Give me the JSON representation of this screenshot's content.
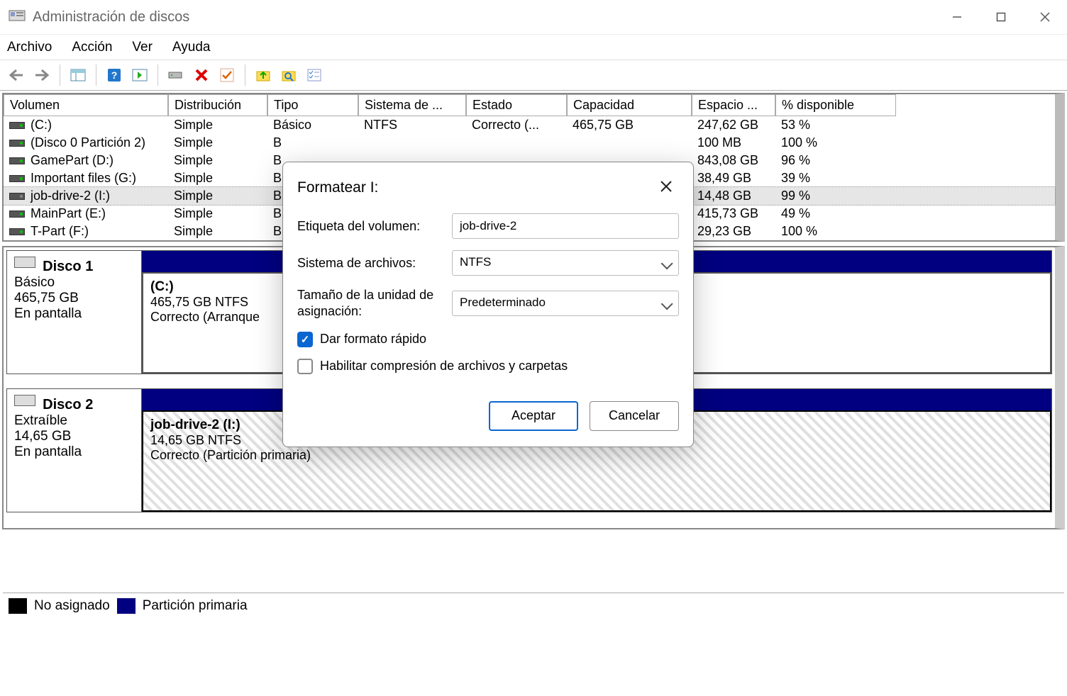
{
  "window": {
    "title": "Administración de discos"
  },
  "menu": {
    "file": "Archivo",
    "action": "Acción",
    "view": "Ver",
    "help": "Ayuda"
  },
  "columns": {
    "vol": "Volumen",
    "dist": "Distribución",
    "tipo": "Tipo",
    "fs": "Sistema de ...",
    "estado": "Estado",
    "cap": "Capacidad",
    "free": "Espacio ...",
    "pct": "% disponible"
  },
  "rows": [
    {
      "name": "(C:)",
      "dist": "Simple",
      "tipo": "Básico",
      "fs": "NTFS",
      "estado": "Correcto (...",
      "cap": "465,75 GB",
      "free": "247,62 GB",
      "pct": "53 %"
    },
    {
      "name": "(Disco 0 Partición 2)",
      "dist": "Simple",
      "tipo": "B",
      "fs": "",
      "estado": "",
      "cap": "",
      "free": "100 MB",
      "pct": "100 %"
    },
    {
      "name": "GamePart (D:)",
      "dist": "Simple",
      "tipo": "B",
      "fs": "",
      "estado": "",
      "cap": "",
      "free": "843,08 GB",
      "pct": "96 %"
    },
    {
      "name": "Important files (G:)",
      "dist": "Simple",
      "tipo": "B",
      "fs": "",
      "estado": "",
      "cap": "",
      "free": "38,49 GB",
      "pct": "39 %"
    },
    {
      "name": "job-drive-2 (I:)",
      "dist": "Simple",
      "tipo": "B",
      "fs": "",
      "estado": "",
      "cap": "",
      "free": "14,48 GB",
      "pct": "99 %",
      "selected": true,
      "off": true
    },
    {
      "name": "MainPart (E:)",
      "dist": "Simple",
      "tipo": "B",
      "fs": "",
      "estado": "",
      "cap": "",
      "free": "415,73 GB",
      "pct": "49 %"
    },
    {
      "name": "T-Part (F:)",
      "dist": "Simple",
      "tipo": "B",
      "fs": "",
      "estado": "",
      "cap": "",
      "free": "29,23 GB",
      "pct": "100 %"
    }
  ],
  "disks": {
    "d1": {
      "name": "Disco 1",
      "type": "Básico",
      "size": "465,75 GB",
      "status": "En pantalla",
      "part": {
        "name": "(C:)",
        "size_fs": "465,75 GB NTFS",
        "state": "Correcto (Arranque"
      }
    },
    "d2": {
      "name": "Disco 2",
      "type": "Extraíble",
      "size": "14,65 GB",
      "status": "En pantalla",
      "part": {
        "name": "job-drive-2  (I:)",
        "size_fs": "14,65 GB NTFS",
        "state": "Correcto (Partición primaria)"
      }
    }
  },
  "legend": {
    "unassigned": "No asignado",
    "primary": "Partición primaria"
  },
  "dialog": {
    "title": "Formatear I:",
    "label_volume": "Etiqueta del volumen:",
    "value_volume": "job-drive-2",
    "label_fs": "Sistema de archivos:",
    "value_fs": "NTFS",
    "label_alloc": "Tamaño de la unidad de asignación:",
    "value_alloc": "Predeterminado",
    "chk_quick": "Dar formato rápido",
    "chk_compress": "Habilitar compresión de archivos y carpetas",
    "btn_ok": "Aceptar",
    "btn_cancel": "Cancelar"
  }
}
